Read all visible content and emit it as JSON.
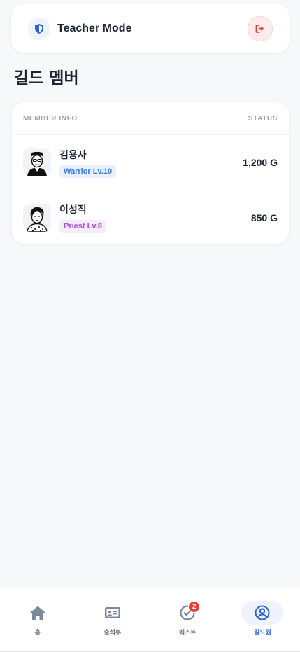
{
  "header": {
    "mode_title": "Teacher Mode",
    "mode_icon": "shield-icon",
    "logout_icon": "logout-icon"
  },
  "page": {
    "title": "길드 멤버"
  },
  "members_table": {
    "col_member": "MEMBER INFO",
    "col_status": "STATUS",
    "rows": [
      {
        "name": "김용사",
        "badge": "Warrior Lv.10",
        "gold": "1,200 G"
      },
      {
        "name": "이성직",
        "badge": "Priest Lv.8",
        "gold": "850 G"
      }
    ]
  },
  "nav": {
    "items": [
      {
        "label": "홈",
        "icon": "home-icon"
      },
      {
        "label": "출석부",
        "icon": "attendance-card-icon"
      },
      {
        "label": "퀘스트",
        "icon": "quest-check-icon",
        "badge": "2"
      },
      {
        "label": "길드원",
        "icon": "guild-member-icon",
        "active": true
      }
    ]
  },
  "colors": {
    "accent": "#2763d6",
    "danger": "#e53b3b",
    "warrior": "#3b79e6",
    "priest": "#a84be0"
  }
}
